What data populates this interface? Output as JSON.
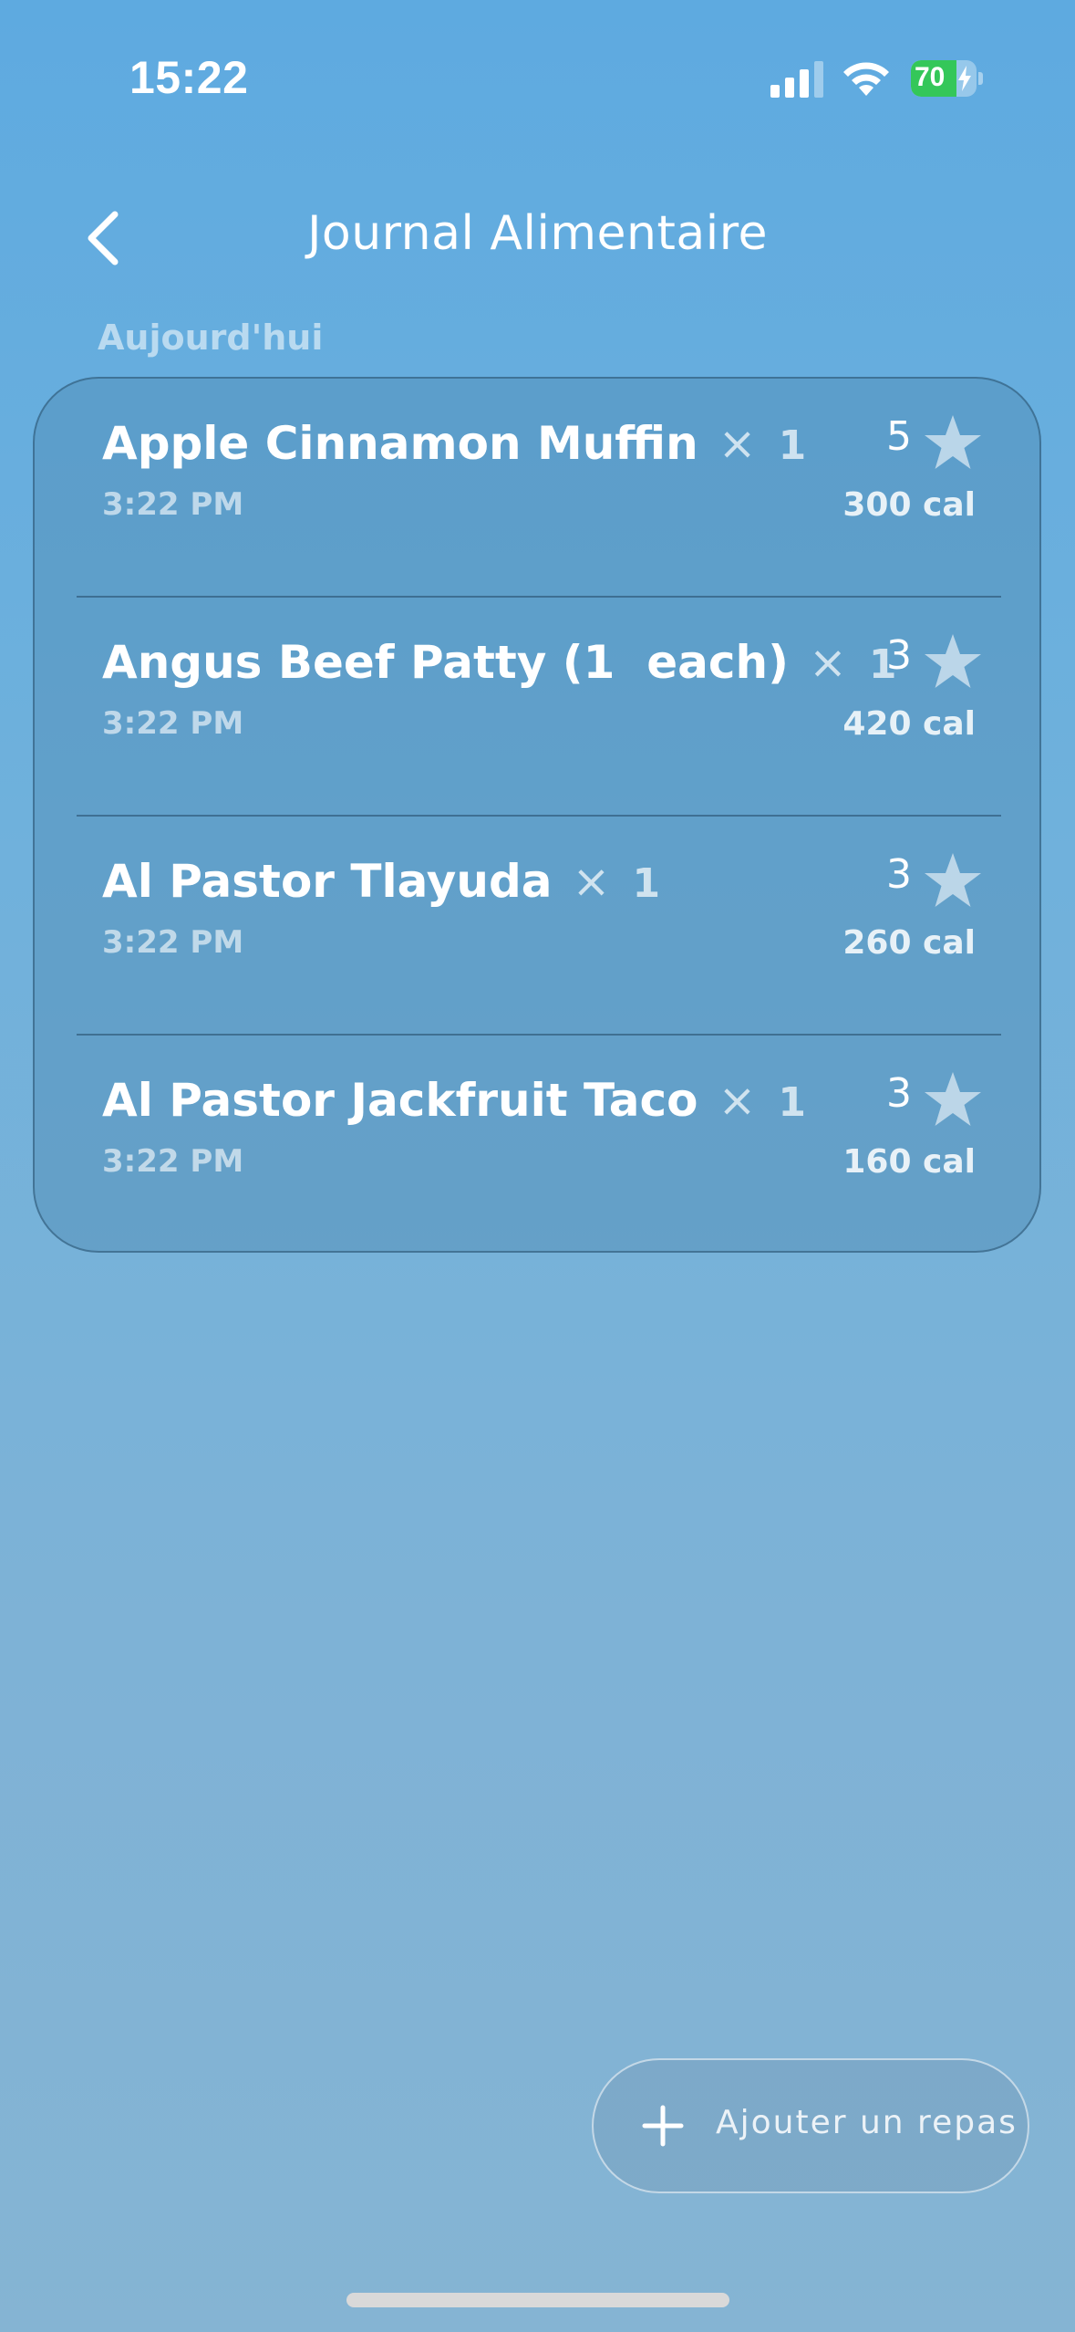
{
  "status_bar": {
    "time": "15:22",
    "battery_level": "70",
    "battery_fraction": 0.7,
    "icons": [
      "signal-icon",
      "wifi-icon",
      "battery-icon",
      "charging-bolt-icon"
    ],
    "battery_color": "#34c759"
  },
  "header": {
    "title": "Journal Alimentaire",
    "back_icon": "chevron-left-icon"
  },
  "section": {
    "label": "Aujourd'hui"
  },
  "meals": [
    {
      "name": "Apple Cinnamon Muffin",
      "multiplier": "×",
      "quantity": "1",
      "time": "3:22 PM",
      "rating": "5",
      "calories": "300 cal"
    },
    {
      "name": "Angus Beef Patty (1  each)",
      "multiplier": "×",
      "quantity": "1",
      "time": "3:22 PM",
      "rating": "3",
      "calories": "420 cal"
    },
    {
      "name": "Al Pastor Tlayuda",
      "multiplier": "×",
      "quantity": "1",
      "time": "3:22 PM",
      "rating": "3",
      "calories": "260 cal"
    },
    {
      "name": "Al Pastor Jackfruit Taco",
      "multiplier": "×",
      "quantity": "1",
      "time": "3:22 PM",
      "rating": "3",
      "calories": "160 cal"
    }
  ],
  "add_button": {
    "label": "Ajouter un repas",
    "icon": "plus-icon"
  }
}
